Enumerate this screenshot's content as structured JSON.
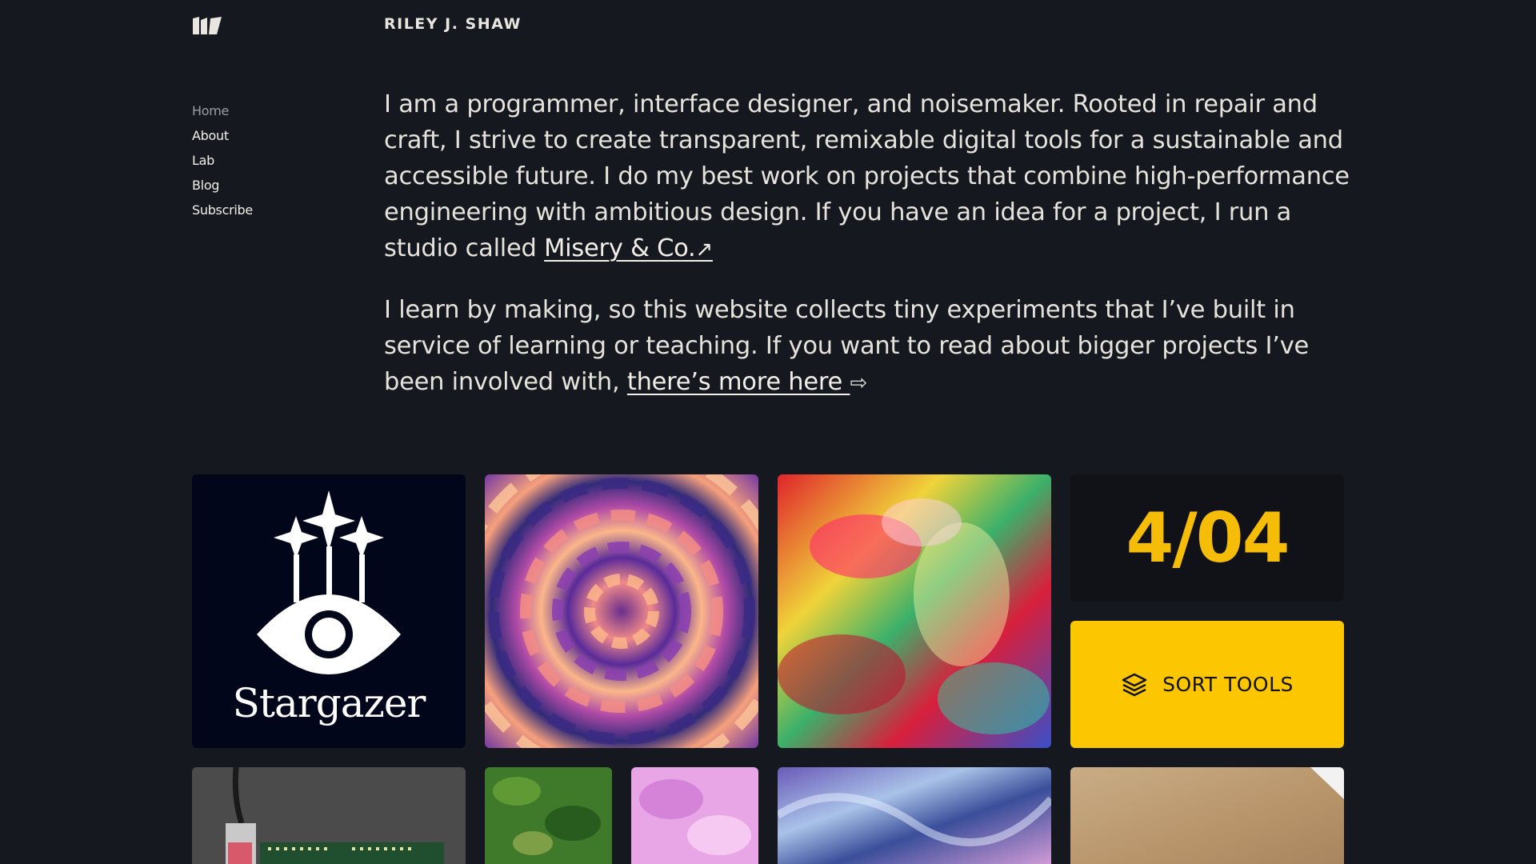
{
  "header": {
    "site_name": "RILEY J. SHAW",
    "logo_icon": "double-page-logo-icon"
  },
  "nav": {
    "items": [
      {
        "label": "Home",
        "active": true
      },
      {
        "label": "About"
      },
      {
        "label": "Lab"
      },
      {
        "label": "Blog"
      },
      {
        "label": "Subscribe"
      }
    ]
  },
  "intro": {
    "p1_text": "I am a programmer, interface designer, and noisemaker. Rooted in repair and craft, I strive to create transparent, remixable digital tools for a sustainable and accessible future. I do my best work on projects that combine high-performance engineering with ambitious design. If you have an idea for a project, I run a studio called ",
    "p1_link": "Misery & Co.",
    "p1_link_arrow": "↗",
    "p2_text": "I learn by making, so this website collects tiny experiments that I’ve built in service of learning or teaching. If you want to read about bigger projects I’ve been involved with, ",
    "p2_link": "there’s more here",
    "p2_link_arrow": "⇨"
  },
  "tiles": {
    "stargazer_word": "Stargazer",
    "counter": "4/04",
    "sort_label": "SORT TOOLS",
    "sort_icon": "layers-icon"
  },
  "colors": {
    "background": "#161820",
    "accent": "#fcc600",
    "counter_text": "#f5bd08"
  }
}
